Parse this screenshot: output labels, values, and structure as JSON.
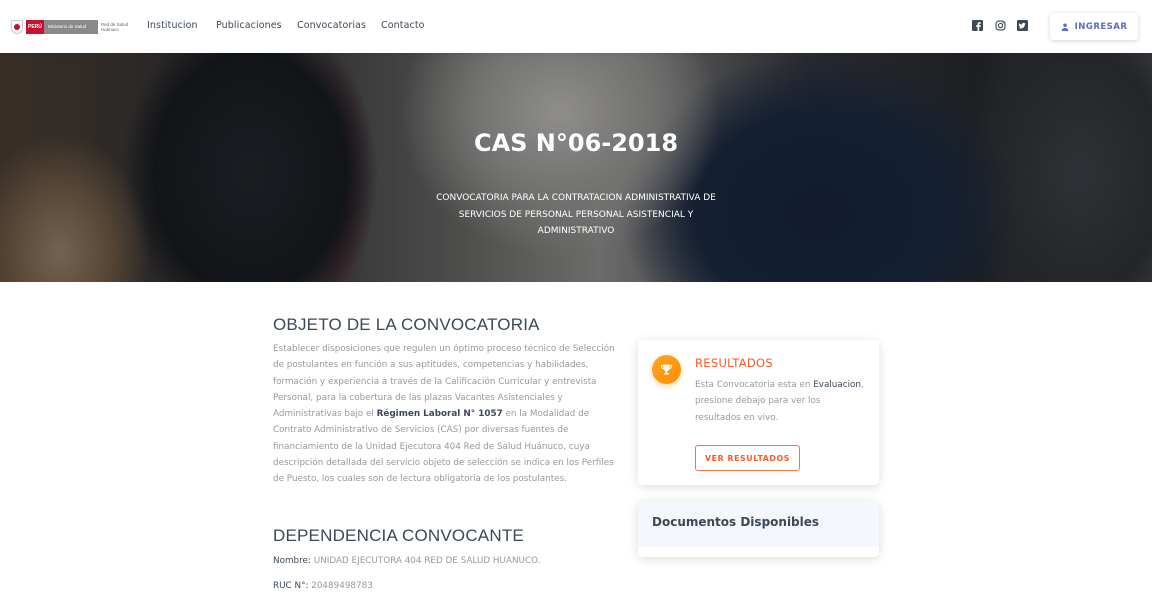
{
  "logo": {
    "peru": "PERÚ",
    "ministry": "Ministerio de Salud",
    "network": "Red de Salud Huánuco"
  },
  "nav": {
    "items": [
      {
        "label": "Institucion"
      },
      {
        "label": "Publicaciones"
      },
      {
        "label": "Convocatorias"
      },
      {
        "label": "Contacto"
      }
    ],
    "social": [
      "facebook-icon",
      "instagram-icon",
      "twitter-icon"
    ],
    "login_label": "INGRESAR"
  },
  "hero": {
    "title": "CAS N°06-2018",
    "subtitle": "CONVOCATORIA PARA LA CONTRATACION ADMINISTRATIVA DE SERVICIOS DE PERSONAL PERSONAL ASISTENCIAL Y ADMINISTRATIVO"
  },
  "objeto": {
    "title": "OBJETO DE LA CONVOCATORIA",
    "text_1": "Establecer disposiciones que regulen un óptimo proceso técnico de Selección de postulantes en función a sus aptitudes, competencias y habilidades, formación y experiencia a través de la Calificación Curricular y entrevista Personal, para la cobertura de las plazas Vacantes Asistenciales y Administrativas bajo el ",
    "highlight": "Régimen Laboral N° 1057",
    "text_2": " en la Modalidad de Contrato Administrativo de Servicios (CAS) por diversas fuentes de financiamiento de la Unidad Ejecutora 404 Red de Salud Huánuco, cuya descripción detallada del servicio objeto de selección se indica en los Perfiles de Puesto, los cuales son de lectura obligatoria de los postulantes."
  },
  "dependencia": {
    "title": "DEPENDENCIA CONVOCANTE",
    "nombre_label": "Nombre:",
    "nombre_value": "UNIDAD EJECUTORA 404 RED DE SALUD HUANUCO.",
    "ruc_label": "RUC N°:",
    "ruc_value": "20489498783"
  },
  "resultados": {
    "title": "RESULTADOS",
    "text_1": "Esta Convocatoria esta en ",
    "status": "Evaluacion",
    "text_2": ", presione debajo para ver los resultados en vivo.",
    "button": "VER RESULTADOS"
  },
  "documentos": {
    "title": "Documentos Disponibles"
  },
  "colors": {
    "accent_orange": "#ff5722",
    "login_blue": "#5c6bc0",
    "heading": "#3c4858"
  }
}
